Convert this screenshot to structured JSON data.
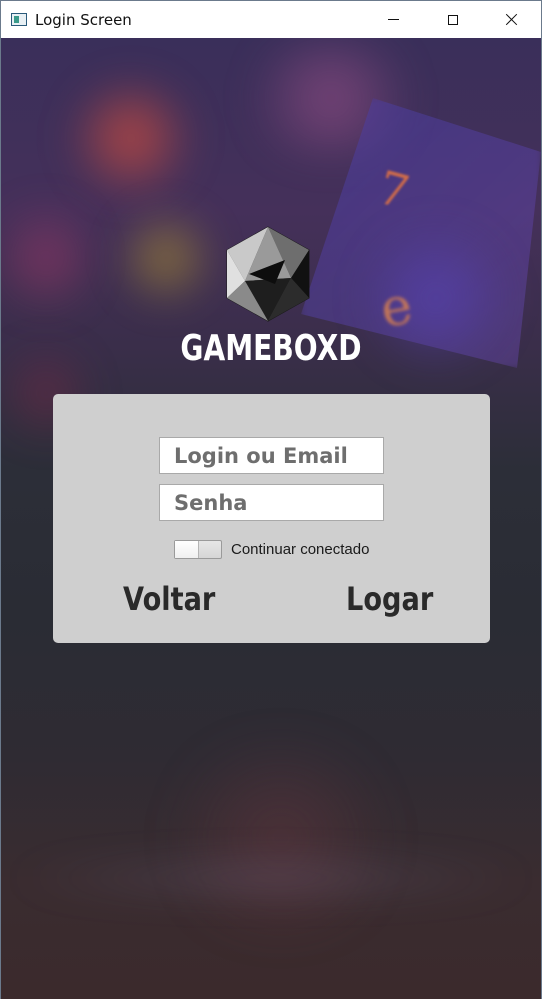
{
  "window": {
    "title": "Login Screen",
    "controls": {
      "minimize": "minimize-icon",
      "maximize": "maximize-icon",
      "close": "close-icon"
    }
  },
  "brand": {
    "name": "GAMEBOXD",
    "logo_icon": "d20-dice-icon"
  },
  "login_form": {
    "login_placeholder": "Login ou Email",
    "login_value": "",
    "password_placeholder": "Senha",
    "password_value": "",
    "remember_label": "Continuar conectado",
    "remember_checked": false,
    "back_label": "Voltar",
    "submit_label": "Logar"
  },
  "colors": {
    "panel": "#cfcfcf",
    "button_text": "#2a2a2a",
    "brand_text": "#ffffff"
  }
}
